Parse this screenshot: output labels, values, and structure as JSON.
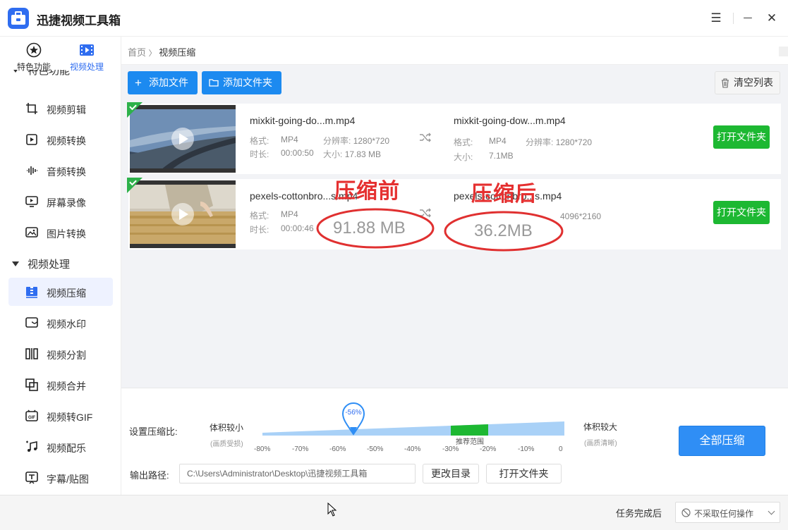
{
  "app": {
    "title": "迅捷视频工具箱"
  },
  "window_controls": {
    "menu": "☰",
    "minimize": "—",
    "close": "✕"
  },
  "sidebar": {
    "top_nav": [
      {
        "label": "特色功能",
        "icon": "star-icon"
      },
      {
        "label": "视频处理",
        "icon": "film-icon"
      }
    ],
    "cut_section_label": "特色功能",
    "items_top": [
      {
        "label": "视频剪辑",
        "icon": "crop-icon"
      },
      {
        "label": "视频转换",
        "icon": "video-convert-icon"
      },
      {
        "label": "音频转换",
        "icon": "audio-wave-icon"
      },
      {
        "label": "屏幕录像",
        "icon": "screen-record-icon"
      },
      {
        "label": "图片转换",
        "icon": "image-icon"
      }
    ],
    "section_label": "视频处理",
    "items_bottom": [
      {
        "label": "视频压缩",
        "icon": "compress-icon",
        "active": true
      },
      {
        "label": "视频水印",
        "icon": "watermark-icon"
      },
      {
        "label": "视频分割",
        "icon": "split-icon"
      },
      {
        "label": "视频合并",
        "icon": "merge-icon"
      },
      {
        "label": "视频转GIF",
        "icon": "gif-icon"
      },
      {
        "label": "视频配乐",
        "icon": "music-icon"
      },
      {
        "label": "字幕/贴图",
        "icon": "subtitle-icon"
      }
    ]
  },
  "breadcrumb": {
    "home": "首页",
    "separator": "〉",
    "current": "视频压缩"
  },
  "toolbar": {
    "add_file": "添加文件",
    "add_folder": "添加文件夹",
    "clear_list": "清空列表"
  },
  "files": [
    {
      "name": "mixkit-going-do...m.mp4",
      "format_label": "格式:",
      "format": "MP4",
      "res_label": "分辨率:",
      "resolution": "1280*720",
      "duration_label": "时长:",
      "duration": "00:00:50",
      "size_label": "大小:",
      "size": "17.83 MB",
      "out_name": "mixkit-going-dow...m.mp4",
      "out_format": "MP4",
      "out_resolution": "1280*720",
      "out_size": "7.1MB",
      "open_folder": "打开文件夹"
    },
    {
      "name": "pexels-cottonbro...s.mp4",
      "format_label": "格式:",
      "format": "MP4",
      "duration_label": "时长:",
      "duration": "00:00:46",
      "out_name": "pexels-cottonbro...s.mp4",
      "out_resolution": "4096*2160",
      "open_folder": "打开文件夹"
    }
  ],
  "annotations": {
    "before_label": "压缩前",
    "before_size": "91.88 MB",
    "after_label": "压缩后",
    "after_size": "36.2MB"
  },
  "compression": {
    "label": "设置压缩比:",
    "left_title": "体积较小",
    "left_hint": "(画质受损)",
    "right_title": "体积较大",
    "right_hint": "(画质清晰)",
    "marker": "-56%",
    "marker_value": -56,
    "recommended": "推荐范围",
    "ticks": [
      "-80%",
      "-70%",
      "-60%",
      "-50%",
      "-40%",
      "-30%",
      "-20%",
      "-10%",
      "0"
    ],
    "compress_all": "全部压缩"
  },
  "output": {
    "label": "输出路径:",
    "path": "C:\\Users\\Administrator\\Desktop\\迅捷视频工具箱",
    "change_dir": "更改目录",
    "open_folder": "打开文件夹"
  },
  "status": {
    "after_task_label": "任务完成后",
    "after_task_value": "不采取任何操作"
  },
  "colors": {
    "accent": "#1c8af0",
    "green": "#1db832",
    "annotation": "#e53030"
  }
}
